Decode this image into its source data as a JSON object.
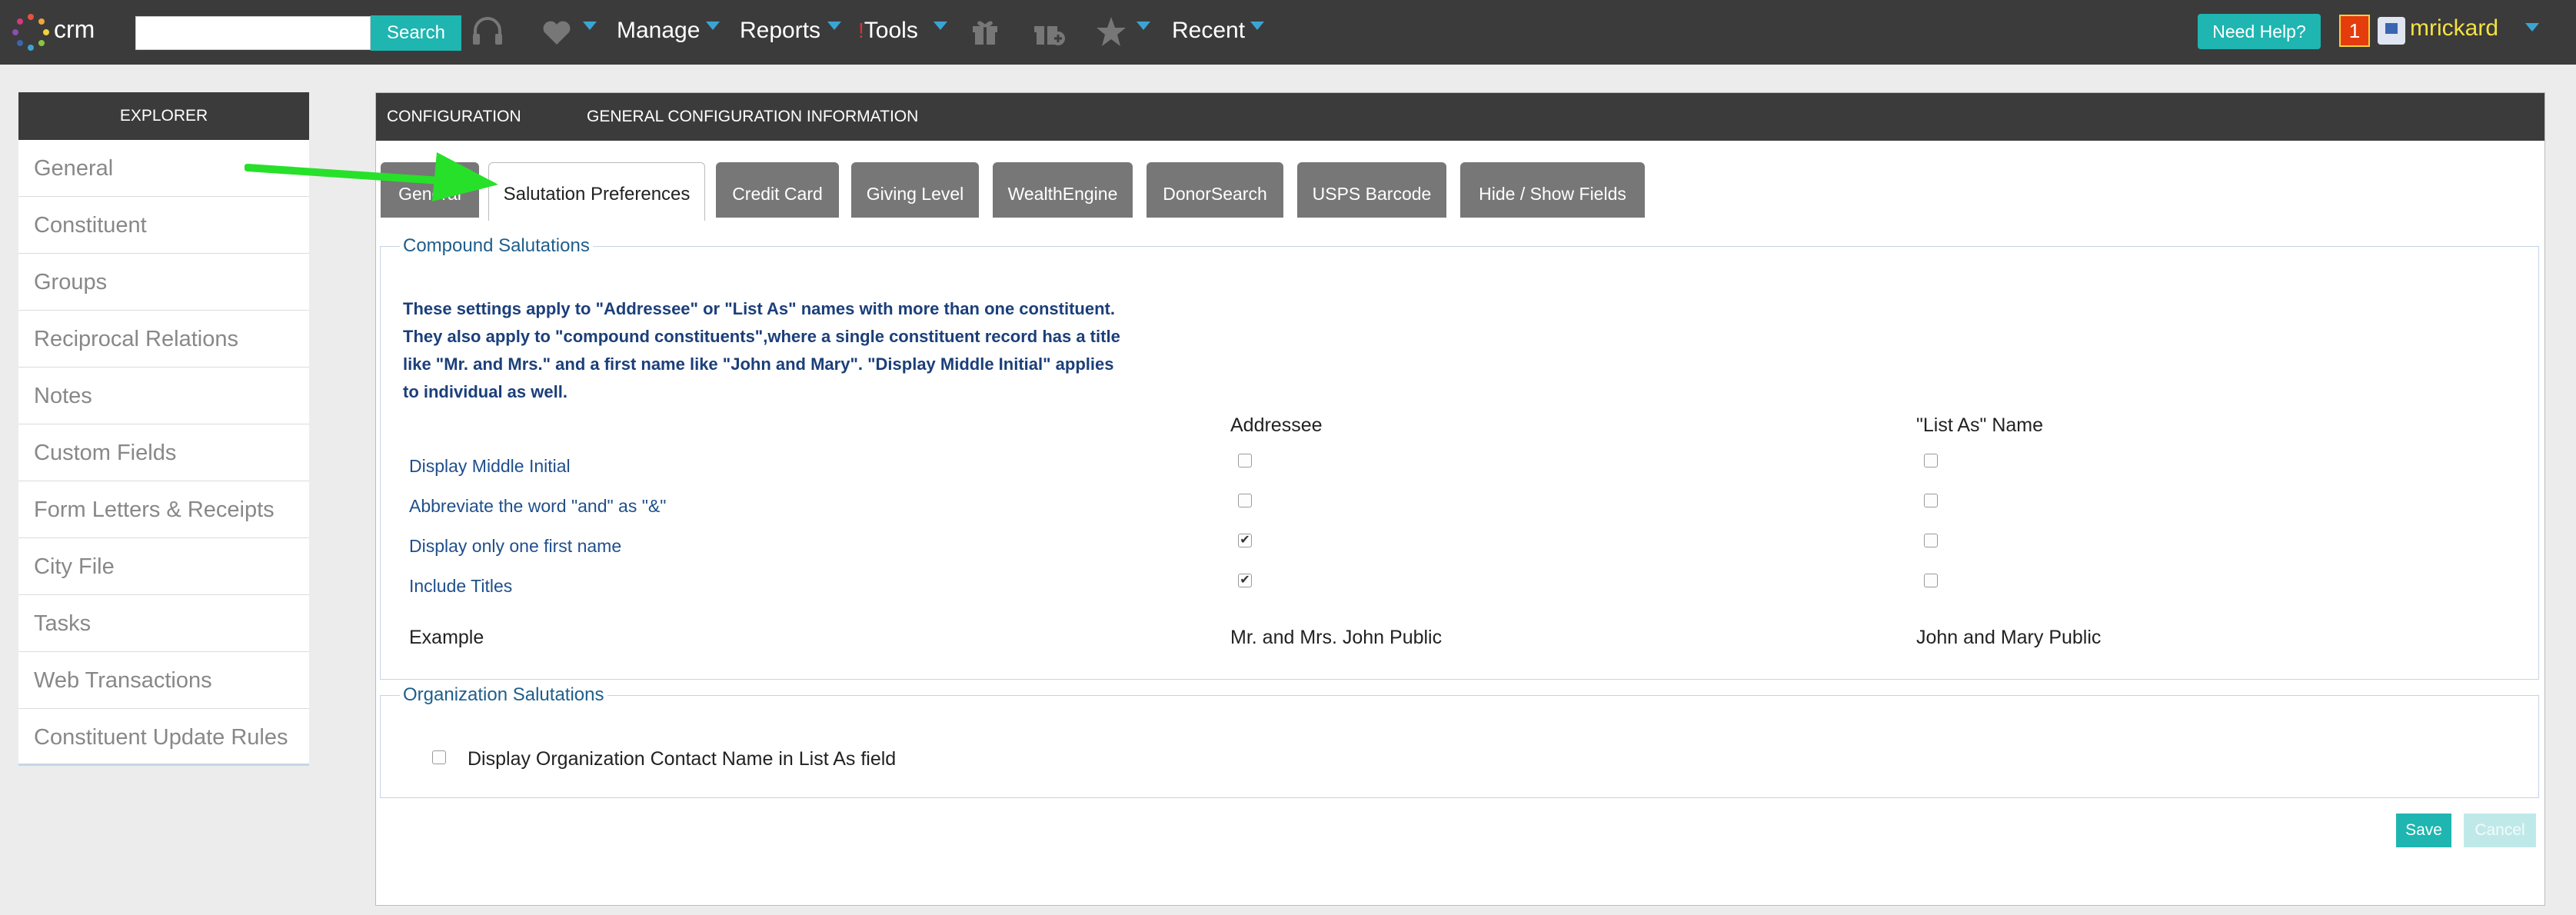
{
  "topbar": {
    "logo_text": "crm",
    "search": {
      "value": "",
      "placeholder": "",
      "button_label": "Search"
    },
    "menus": [
      {
        "label": "Manage"
      },
      {
        "label": "Reports"
      },
      {
        "label": "Tools",
        "mark": "!"
      },
      {
        "label": "Recent"
      }
    ],
    "help_label": "Need Help?",
    "notification_count": "1",
    "username": "mrickard",
    "icons": [
      "headset-icon",
      "heart-icon",
      "gift-icon",
      "gift-add-icon",
      "star-icon"
    ]
  },
  "explorer": {
    "title": "EXPLORER",
    "items": [
      {
        "label": "General"
      },
      {
        "label": "Constituent"
      },
      {
        "label": "Groups"
      },
      {
        "label": "Reciprocal Relations"
      },
      {
        "label": "Notes"
      },
      {
        "label": "Custom Fields"
      },
      {
        "label": "Form Letters & Receipts"
      },
      {
        "label": "City File"
      },
      {
        "label": "Tasks"
      },
      {
        "label": "Web Transactions"
      },
      {
        "label": "Constituent Update Rules"
      }
    ]
  },
  "panel": {
    "breadcrumb_left": "CONFIGURATION",
    "breadcrumb_right": "GENERAL CONFIGURATION INFORMATION",
    "tabs": [
      {
        "label": "General",
        "active": false
      },
      {
        "label": "Salutation Preferences",
        "active": true
      },
      {
        "label": "Credit Card",
        "active": false
      },
      {
        "label": "Giving Level",
        "active": false
      },
      {
        "label": "WealthEngine",
        "active": false
      },
      {
        "label": "DonorSearch",
        "active": false
      },
      {
        "label": "USPS Barcode",
        "active": false
      },
      {
        "label": "Hide / Show Fields",
        "active": false
      }
    ],
    "compound": {
      "legend": "Compound Salutations",
      "intro_lines": [
        "These settings apply to \"Addressee\" or \"List As\" names with more than one constituent.",
        "They also apply to \"compound constituents\",where a single constituent record has a title",
        "like \"Mr. and Mrs.\" and a first name like \"John and Mary\". \"Display Middle Initial\" applies",
        "to individual as well."
      ],
      "col_addressee": "Addressee",
      "col_list_as": "\"List As\" Name",
      "rows": [
        {
          "label": "Display Middle Initial",
          "addressee": false,
          "list_as": false
        },
        {
          "label": "Abbreviate the word \"and\" as \"&\"",
          "addressee": false,
          "list_as": false
        },
        {
          "label": "Display only one first name",
          "addressee": true,
          "list_as": false
        },
        {
          "label": "Include Titles",
          "addressee": true,
          "list_as": false
        }
      ],
      "example_label": "Example",
      "example_addressee": "Mr. and Mrs. John Public",
      "example_list_as": "John and Mary Public"
    },
    "organization": {
      "legend": "Organization Salutations",
      "option_label": "Display Organization Contact Name in List As field",
      "option_checked": false
    },
    "save_label": "Save",
    "cancel_label": "Cancel"
  },
  "colors": {
    "accent": "#1fb5b0",
    "topbar": "#3b3b3b",
    "username": "#f3e142",
    "annotation_arrow": "#27e02a"
  }
}
